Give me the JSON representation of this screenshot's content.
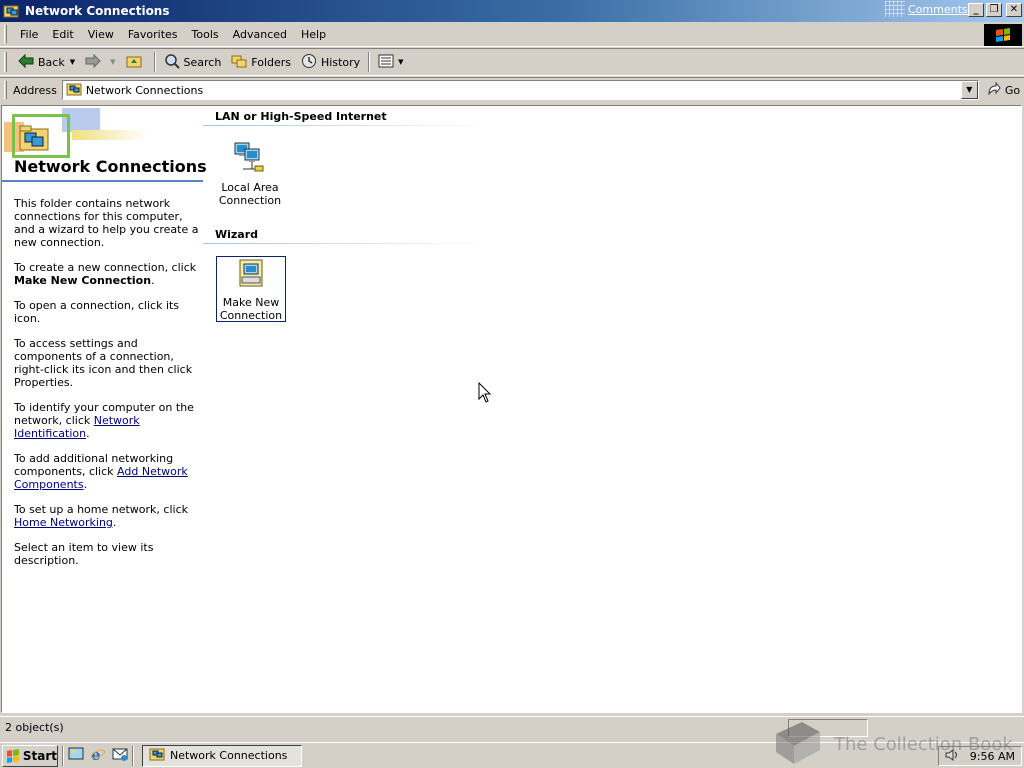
{
  "window": {
    "title": "Network Connections",
    "comments_link": "Comments?",
    "icons": {
      "app": "network-folder-icon",
      "minimize": "minimize-icon",
      "restore": "restore-icon",
      "close": "close-icon"
    }
  },
  "menubar": {
    "items": [
      "File",
      "Edit",
      "View",
      "Favorites",
      "Tools",
      "Advanced",
      "Help"
    ]
  },
  "toolbar": {
    "back": "Back",
    "search": "Search",
    "folders": "Folders",
    "history": "History"
  },
  "address": {
    "label": "Address",
    "value": "Network Connections",
    "go": "Go"
  },
  "sidebar": {
    "title": "Network Connections",
    "intro": "This folder contains network connections for this computer, and a wizard to help you create a new connection.",
    "create_prefix": "To create a new connection, click",
    "create_bold": "Make New Connection",
    "create_suffix": ".",
    "open": "To open a connection, click its icon.",
    "access": "To access settings and components of a connection, right-click its icon and then click Properties.",
    "identify_prefix": "To identify your computer on the network, click",
    "identify_link": "Network Identification",
    "identify_suffix": ".",
    "add_prefix": "To add additional networking components, click",
    "add_link": "Add Network Components",
    "add_suffix": ".",
    "home_prefix": "To set up a home network, click",
    "home_link": "Home Networking",
    "home_suffix": ".",
    "select": "Select an item to view its description."
  },
  "groups": {
    "lan": {
      "title": "LAN or High-Speed Internet",
      "item_label_1": "Local Area",
      "item_label_2": "Connection"
    },
    "wizard": {
      "title": "Wizard",
      "item_label_1": "Make New",
      "item_label_2": "Connection"
    }
  },
  "statusbar": {
    "objects": "2 object(s)"
  },
  "taskbar": {
    "start": "Start",
    "task": "Network Connections",
    "clock": "9:56 AM"
  },
  "watermark": {
    "text": "The Collection Book"
  },
  "colors": {
    "title_gradient_start": "#0a246a",
    "title_gradient_end": "#a6caf0",
    "link": "#00007f",
    "face": "#d4d0c8"
  }
}
